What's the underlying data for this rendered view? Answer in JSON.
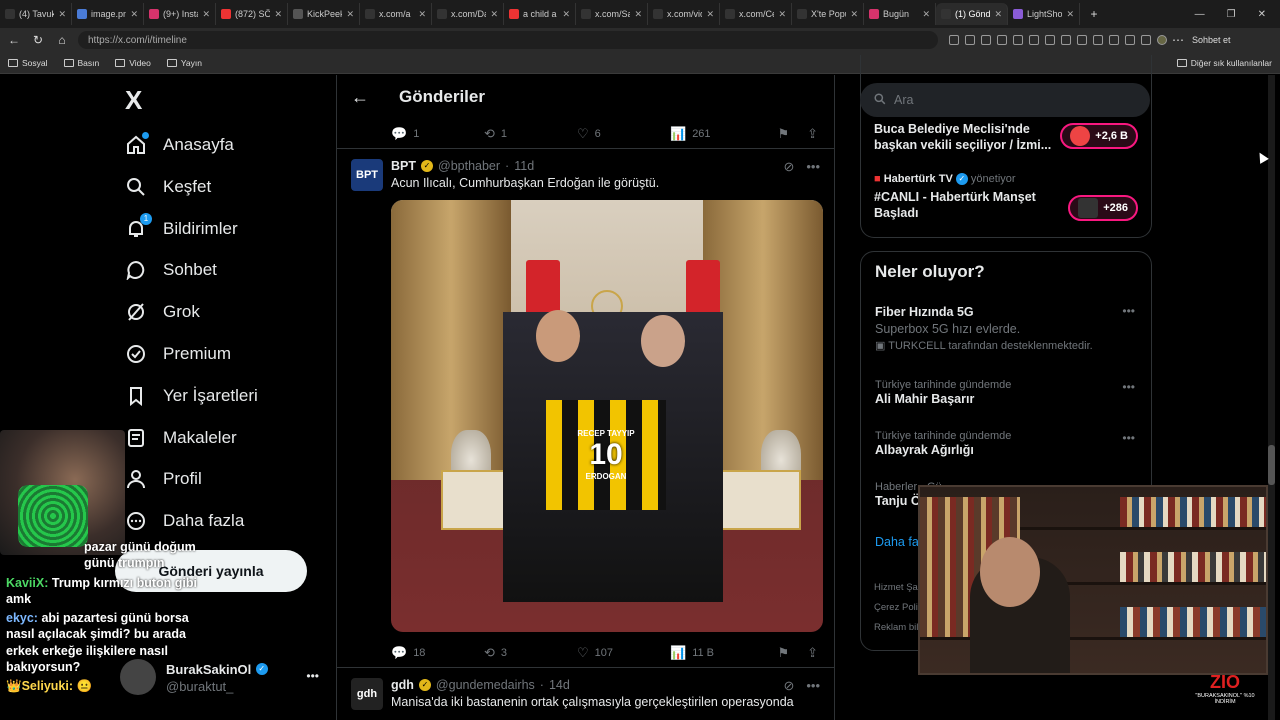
{
  "browser": {
    "tabs": [
      {
        "label": "(4) Tavuk",
        "color": "#333"
      },
      {
        "label": "image.pn",
        "color": "#4a7bd6"
      },
      {
        "label": "(9+) Insta",
        "color": "#d6336c"
      },
      {
        "label": "(872) SÖZ",
        "color": "#e33"
      },
      {
        "label": "KickPeek",
        "color": "#555"
      },
      {
        "label": "x.com/a",
        "color": "#333"
      },
      {
        "label": "x.com/Da",
        "color": "#333"
      },
      {
        "label": "a child a",
        "color": "#e33"
      },
      {
        "label": "x.com/Sa",
        "color": "#333"
      },
      {
        "label": "x.com/vid",
        "color": "#333"
      },
      {
        "label": "x.com/Ce",
        "color": "#333"
      },
      {
        "label": "X'te Popu",
        "color": "#333"
      },
      {
        "label": "Bugün",
        "color": "#d6336c"
      },
      {
        "label": "(1) Gönde",
        "color": "#333"
      },
      {
        "label": "LightShot",
        "color": "#8a5cd6"
      }
    ],
    "url": "https://x.com/i/timeline",
    "copilot_label": "Sohbet et",
    "bookmarks": [
      "Sosyal",
      "Basın",
      "Video",
      "Yayın"
    ],
    "bookmarks_other": "Diğer sık kullanılanlar"
  },
  "nav": {
    "logo": "X",
    "items": [
      {
        "label": "Anasayfa",
        "icon": "home-icon"
      },
      {
        "label": "Keşfet",
        "icon": "search-icon"
      },
      {
        "label": "Bildirimler",
        "icon": "bell-icon",
        "badge": "1"
      },
      {
        "label": "Sohbet",
        "icon": "chat-icon"
      },
      {
        "label": "Grok",
        "icon": "grok-icon"
      },
      {
        "label": "Premium",
        "icon": "premium-icon"
      },
      {
        "label": "Yer İşaretleri",
        "icon": "bookmark-icon"
      },
      {
        "label": "Makaleler",
        "icon": "article-icon"
      },
      {
        "label": "Profil",
        "icon": "profile-icon"
      },
      {
        "label": "Daha fazla",
        "icon": "more-circle-icon"
      }
    ],
    "post_button": "Gönderi yayınla",
    "account": {
      "name": "BurakSakinOl",
      "handle": "@buraktut_"
    }
  },
  "chat_overlay": [
    {
      "user": "",
      "text": "pazar günü doğum günü trumpın"
    },
    {
      "user": "KaviiX:",
      "text": "Trump kırmızı buton gibi amk"
    },
    {
      "user": "ekyc:",
      "text": "abi pazartesi günü borsa nasıl açılacak şimdi? bu arada erkek erkeğe ilişkilere nasıl bakıyorsun?"
    },
    {
      "user": "Seliyuki:",
      "text": ""
    }
  ],
  "timeline": {
    "title": "Gönderiler",
    "prev_actions": {
      "replies": "1",
      "reposts": "1",
      "likes": "6",
      "views": "261"
    },
    "tweet1": {
      "avatar": "BPT",
      "name": "BPT",
      "handle": "@bpthaber",
      "time": "11d",
      "text": "Acun Ilıcalı, Cumhurbaşkan Erdoğan ile görüştü.",
      "jersey_name": "RECEP TAYYIP",
      "jersey_number": "10",
      "jersey_back": "ERDOGAN",
      "actions": {
        "replies": "18",
        "reposts": "3",
        "likes": "107",
        "views": "11 B"
      }
    },
    "tweet2": {
      "avatar": "gdh",
      "name": "gdh",
      "handle": "@gundemedairhs",
      "time": "14d",
      "text": "Manisa'da iki bastanenin ortak çalışmasıyla gerçekleştirilen operasyonda"
    }
  },
  "right": {
    "search_placeholder": "Ara",
    "trends_top": [
      {
        "text": "Buca Belediye Meclisi'nde başkan vekili seçiliyor / İzmi...",
        "pill": "+2,6 B"
      },
      {
        "source": "Habertürk TV",
        "source_suffix": "yönetiyor",
        "text": "#CANLI - Habertürk Manşet Başladı",
        "pill": "+286"
      }
    ],
    "whats_happening": {
      "title": "Neler oluyor?",
      "items": [
        {
          "title": "Fiber Hızında 5G",
          "sub": "Superbox 5G hızı evlerde.",
          "promo": "TURKCELL tarafından desteklenmektedir."
        },
        {
          "category": "Türkiye tarihinde gündemde",
          "title": "Ali Mahir Başarır"
        },
        {
          "category": "Türkiye tarihinde gündemde",
          "title": "Albayrak Ağırlığı"
        },
        {
          "category": "Haberler · Gü",
          "title": "Tanju Öz"
        }
      ],
      "show_more": "Daha fa"
    },
    "legal": [
      "Hizmet Şar",
      "Çerez Polit",
      "Reklam bilg"
    ]
  },
  "stream": {
    "logo": "ZIO",
    "logo_sub": "\"BURAKSAKINOL\" %10 İNDİRİM"
  }
}
